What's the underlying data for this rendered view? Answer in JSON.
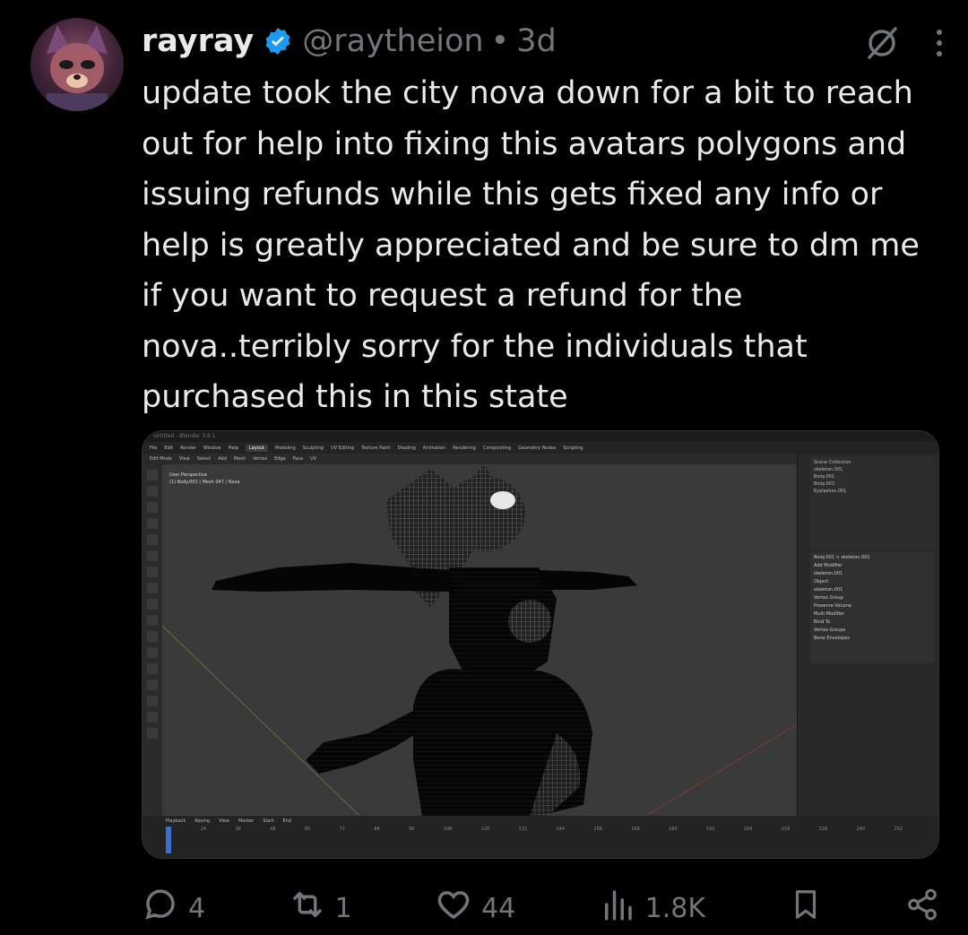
{
  "post": {
    "author_name": "rayray",
    "handle": "@raytheion",
    "separator": "•",
    "time": "3d",
    "text": "update took the city nova down for a bit to reach out for help into fixing this avatars polygons and issuing refunds while this gets fixed any info or help is greatly appreciated and be sure to dm me if you want to request a refund for the nova..terribly sorry for the individuals that purchased this in this state"
  },
  "colors": {
    "background": "#000000",
    "text": "#e7e9ea",
    "muted": "#71767b",
    "verified": "#1d9bf0"
  },
  "icons": {
    "verified": "verified-badge-icon",
    "grok": "grok-icon",
    "more": "more-icon",
    "reply": "reply-icon",
    "repost": "repost-icon",
    "like": "like-icon",
    "views": "views-icon",
    "bookmark": "bookmark-icon",
    "share": "share-icon"
  },
  "media": {
    "title": "untitled - Blender 3.6.1",
    "menu": [
      "File",
      "Edit",
      "Render",
      "Window",
      "Help"
    ],
    "workspaces": [
      "Layout",
      "Modeling",
      "Sculpting",
      "UV Editing",
      "Texture Paint",
      "Shading",
      "Animation",
      "Rendering",
      "Compositing",
      "Geometry Nodes",
      "Scripting"
    ],
    "active_workspace": "Layout",
    "header_items": [
      "Edit Mode",
      "View",
      "Select",
      "Add",
      "Mesh",
      "Vertex",
      "Edge",
      "Face",
      "UV"
    ],
    "viewport_label": "User Perspective",
    "viewport_sublabel": "(1) Body.001 | Mesh 047 / Nova",
    "outliner": [
      "Scene Collection",
      "skeleton.001",
      "Body.001",
      "Body.003",
      "Eyelashes.001"
    ],
    "props_path": "Body.001 > skeleton.001",
    "add_modifier": "Add Modifier",
    "modifier_name": "skeleton.001",
    "modifier_fields": [
      "Object",
      "skeleton.001",
      "Vertex Group",
      "Preserve Volume",
      "Multi Modifier",
      "Bind To",
      "Vertex Groups",
      "Bone Envelopes"
    ],
    "timeline_menu": [
      "Playback",
      "Keying",
      "View",
      "Marker"
    ],
    "timeline_ticks": [
      "12",
      "24",
      "36",
      "48",
      "60",
      "72",
      "84",
      "96",
      "108",
      "120",
      "132",
      "144",
      "156",
      "168",
      "180",
      "192",
      "204",
      "216",
      "228",
      "240",
      "252"
    ],
    "timeline_start": "Start",
    "timeline_end": "End"
  },
  "actions": {
    "replies": "4",
    "reposts": "1",
    "likes": "44",
    "views": "1.8K"
  }
}
